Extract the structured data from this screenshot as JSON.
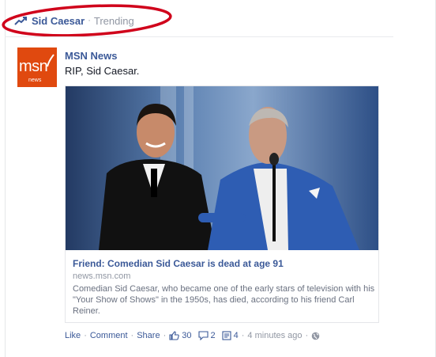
{
  "trending": {
    "icon": "trending-up-icon",
    "topic": "Sid Caesar",
    "separator": "·",
    "label": "Trending",
    "highlight_color": "#d0021b"
  },
  "post": {
    "avatar": {
      "line1": "msn",
      "line2": "news",
      "color": "#e0490f"
    },
    "author": "MSN News",
    "message": "RIP, Sid Caesar.",
    "shared_link": {
      "title": "Friend: Comedian Sid Caesar is dead at age 91",
      "domain": "news.msn.com",
      "description": "Comedian Sid Caesar, who became one of the early stars of television with his \"Your Show of Shows\" in the 1950s, has died, according to his friend Carl Reiner."
    },
    "actions": {
      "like": "Like",
      "comment": "Comment",
      "share": "Share",
      "separator": "·",
      "likes_count": "30",
      "comments_count": "2",
      "shares_count": "4",
      "timestamp": "4 minutes ago"
    }
  },
  "colors": {
    "link": "#3b5998",
    "muted": "#9197a3"
  }
}
